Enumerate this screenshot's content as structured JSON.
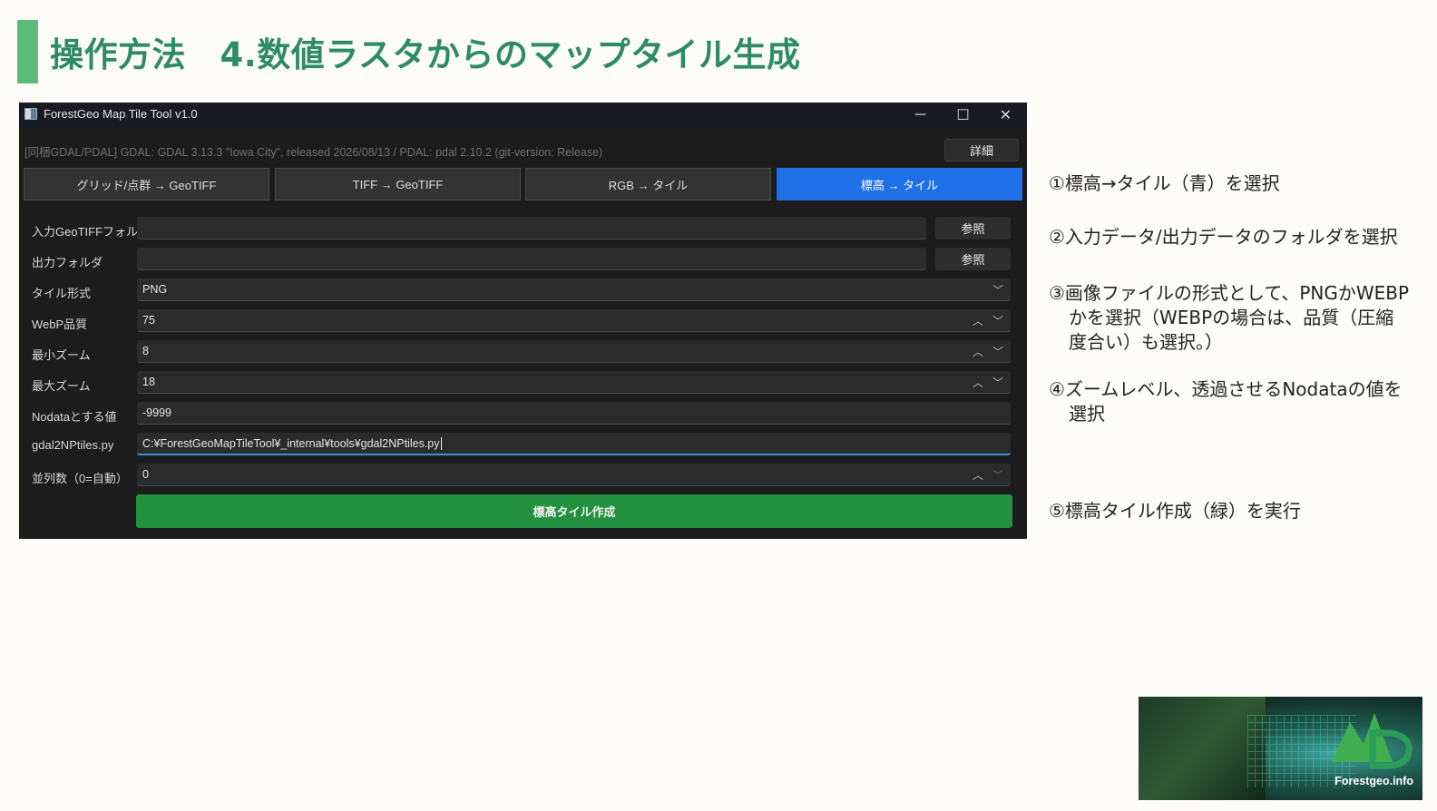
{
  "slide": {
    "title": "操作方法　4.数値ラスタからのマップタイル生成"
  },
  "window": {
    "title": "ForestGeo Map Tile Tool v1.0",
    "version_info": "[同梱GDAL/PDAL]  GDAL: GDAL 3.13.3 \"Iowa City\", released 2026/08/13  /  PDAL: pdal 2.10.2 (git-version: Release)",
    "detail_button": "詳細",
    "controls": {
      "minimize": "─",
      "maximize": "☐",
      "close": "✕"
    }
  },
  "tabs": [
    {
      "label": "グリッド/点群 → GeoTIFF"
    },
    {
      "label": "TIFF → GeoTIFF"
    },
    {
      "label": "RGB → タイル"
    },
    {
      "label": "標高 → タイル"
    }
  ],
  "form": {
    "input_folder": {
      "label": "入力GeoTIFFフォルダ",
      "value": "",
      "browse": "参照"
    },
    "output_folder": {
      "label": "出力フォルダ",
      "value": "",
      "browse": "参照"
    },
    "tile_format": {
      "label": "タイル形式",
      "value": "PNG"
    },
    "webp_quality": {
      "label": "WebP品質",
      "value": "75"
    },
    "min_zoom": {
      "label": "最小ズーム",
      "value": "8"
    },
    "max_zoom": {
      "label": "最大ズーム",
      "value": "18"
    },
    "nodata": {
      "label": "Nodataとする値",
      "value": "-9999"
    },
    "script_path": {
      "label": "gdal2NPtiles.py",
      "value": "C:¥ForestGeoMapTileTool¥_internal¥tools¥gdal2NPtiles.py"
    },
    "parallel": {
      "label": "並列数（0=自動）",
      "value": "0"
    },
    "execute_button": "標高タイル作成"
  },
  "steps": {
    "s1": [
      "①標高→タイル（青）を選択"
    ],
    "s2": [
      "②入力データ/出力データのフォルダを選択"
    ],
    "s3": [
      "③画像ファイルの形式として、PNGかWEBP",
      "かを選択（WEBPの場合は、品質（圧縮",
      "度合い）も選択。）"
    ],
    "s4": [
      "④ズームレベル、透過させるNodataの値を",
      "選択"
    ],
    "s5": [
      "⑤標高タイル作成（緑）を実行"
    ]
  },
  "logo": {
    "text": "Forestgeo.info"
  },
  "colors": {
    "title": "#2e8b67",
    "title_bar": "#5dbb78",
    "active_tab": "#1f6fe6",
    "execute": "#21913f"
  }
}
